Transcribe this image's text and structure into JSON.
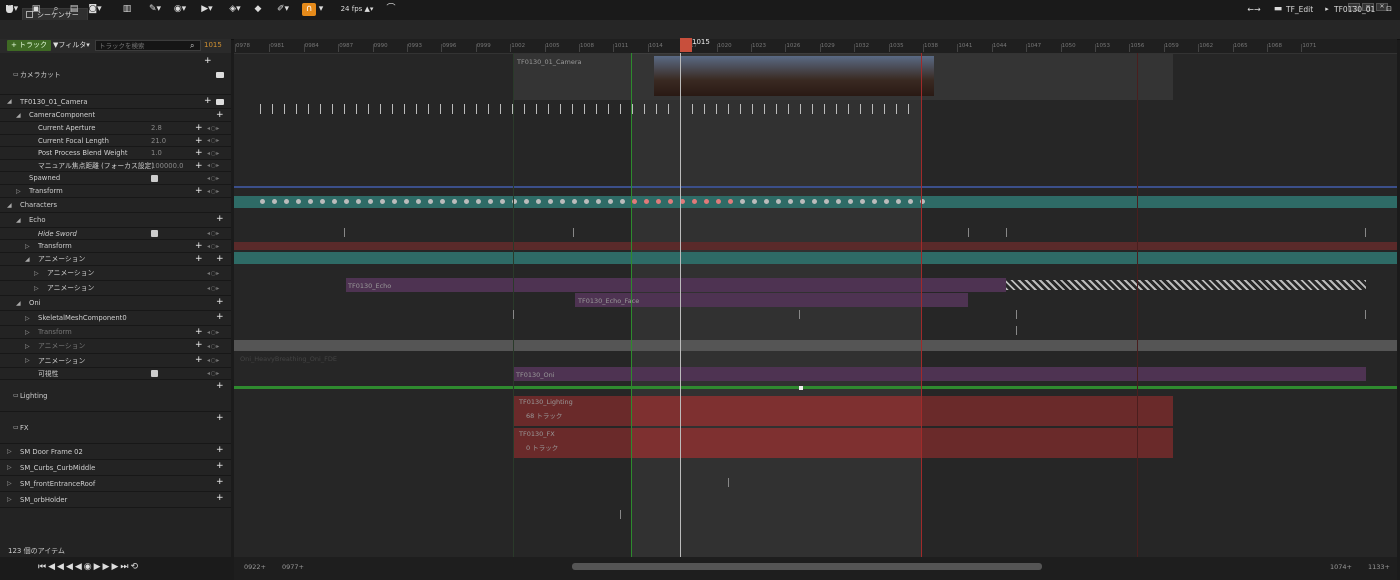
{
  "window": {
    "tab_label": "シーケンサー",
    "minimize": "—",
    "restore": "▫",
    "close": "✕"
  },
  "toolbar": {
    "fps": "24 fps",
    "breadcrumb_root": "TF_Edit",
    "breadcrumb_current": "TF0130_01"
  },
  "filter_bar": {
    "add_track": "+ トラック",
    "filter": "フィルタ",
    "search_placeholder": "トラックを検索",
    "current_frame": "1015"
  },
  "tracks": [
    {
      "label": "カメラカット",
      "depth": 0,
      "h": 40,
      "plus": false,
      "plusr": true,
      "cam": true
    },
    {
      "label": "TF0130_01_Camera",
      "depth": 0,
      "h": 14,
      "plus": false,
      "plusr": true,
      "cam": true,
      "tri": "◢"
    },
    {
      "label": "CameraComponent",
      "depth": 1,
      "h": 13,
      "plusr": true,
      "tri": "◢"
    },
    {
      "label": "Current Aperture",
      "depth": 2,
      "h": 13,
      "val": "2.8",
      "plus": true,
      "kf": true
    },
    {
      "label": "Current Focal Length",
      "depth": 2,
      "h": 12,
      "val": "21.0",
      "plus": true,
      "kf": true
    },
    {
      "label": "Post Process Blend Weight",
      "depth": 2,
      "h": 13,
      "val": "1.0",
      "plus": true,
      "kf": true
    },
    {
      "label": "マニュアル焦点距離 (フォーカス設定)",
      "depth": 2,
      "h": 12,
      "val": "100000.0",
      "plus": true,
      "kf": true
    },
    {
      "label": "Spawned",
      "depth": 1,
      "h": 13,
      "chk": true,
      "kf": true
    },
    {
      "label": "Transform",
      "depth": 1,
      "h": 13,
      "plus": true,
      "kf": true,
      "tri": "▷"
    },
    {
      "label": "Characters",
      "depth": 0,
      "h": 15,
      "tri": "◢"
    },
    {
      "label": "Echo",
      "depth": 1,
      "h": 15,
      "plusr": true,
      "tri": "◢"
    },
    {
      "label": "Hide Sword",
      "depth": 2,
      "h": 12,
      "chk": true,
      "kf": true,
      "italic": true
    },
    {
      "label": "Transform",
      "depth": 2,
      "h": 13,
      "plus": true,
      "kf": true,
      "tri": "▷"
    },
    {
      "label": "アニメーション",
      "depth": 2,
      "h": 13,
      "plus": true,
      "plusr": true,
      "tri": "◢"
    },
    {
      "label": "アニメーション",
      "depth": 3,
      "h": 15,
      "kf": true,
      "tri": "▷"
    },
    {
      "label": "アニメーション",
      "depth": 3,
      "h": 15,
      "kf": true,
      "tri": "▷"
    },
    {
      "label": "Oni",
      "depth": 1,
      "h": 15,
      "plusr": true,
      "tri": "◢"
    },
    {
      "label": "SkeletalMeshComponent0",
      "depth": 2,
      "h": 15,
      "plusr": true,
      "tri": "▷"
    },
    {
      "label": "Transform",
      "depth": 2,
      "h": 13,
      "plus": true,
      "kf": true,
      "tri": "▷",
      "dim": true
    },
    {
      "label": "アニメーション",
      "depth": 2,
      "h": 15,
      "plus": true,
      "kf": true,
      "tri": "▷",
      "dim": true
    },
    {
      "label": "アニメーション",
      "depth": 2,
      "h": 14,
      "plus": true,
      "kf": true,
      "tri": "▷"
    },
    {
      "label": "可視性",
      "depth": 2,
      "h": 12,
      "chk": true,
      "kf": true
    },
    {
      "label": "Lighting",
      "depth": 0,
      "h": 32,
      "plusr": true
    },
    {
      "label": "FX",
      "depth": 0,
      "h": 32,
      "plusr": true
    },
    {
      "label": "SM Door Frame 02",
      "depth": 0,
      "h": 16,
      "plusr": true,
      "tri": "▷"
    },
    {
      "label": "SM_Curbs_CurbMiddle",
      "depth": 0,
      "h": 16,
      "plusr": true,
      "tri": "▷"
    },
    {
      "label": "SM_frontEntranceRoof",
      "depth": 0,
      "h": 16,
      "plusr": true,
      "tri": "▷"
    },
    {
      "label": "SM_orbHolder",
      "depth": 0,
      "h": 16,
      "plusr": true,
      "tri": "▷"
    }
  ],
  "status": {
    "item_count": "123 個のアイテム",
    "transport": "⏮◀◀◀◀◉▶▶▶⏭⟲"
  },
  "ruler": {
    "playhead": "1015",
    "ticks": [
      "0978",
      "0981",
      "0984",
      "0987",
      "0990",
      "0993",
      "0996",
      "0999",
      "1002",
      "1005",
      "1008",
      "1011",
      "1014",
      "1017",
      "1020",
      "1023",
      "1026",
      "1029",
      "1032",
      "1035",
      "1038",
      "1041",
      "1044",
      "1047",
      "1050",
      "1053",
      "1056",
      "1059",
      "1062",
      "1065",
      "1068",
      "1071"
    ]
  },
  "sections": {
    "camera_cut": "TF0130_01_Camera",
    "echo_anim": "TF0130_Echo",
    "echo_face": "TF0130_Echo_Face",
    "oni_dim": "Oni_HeavyBreathing_Oni_FDE",
    "oni": "TF0130_Oni",
    "lighting": "TF0130_Lighting",
    "lighting_count": "68 トラック",
    "fx": "TF0130_FX",
    "fx_count": "0 トラック"
  },
  "footer": {
    "view_start": "0922+",
    "work_start": "0977+",
    "work_end": "1074+",
    "view_end": "1133+"
  },
  "colors": {
    "accent_green": "#3f6a24",
    "playhead_red": "#c84f3c",
    "transform_teal": "#2e6b66",
    "anim_purple": "#5a3a5c",
    "lighting_red": "#7a2a2a"
  }
}
